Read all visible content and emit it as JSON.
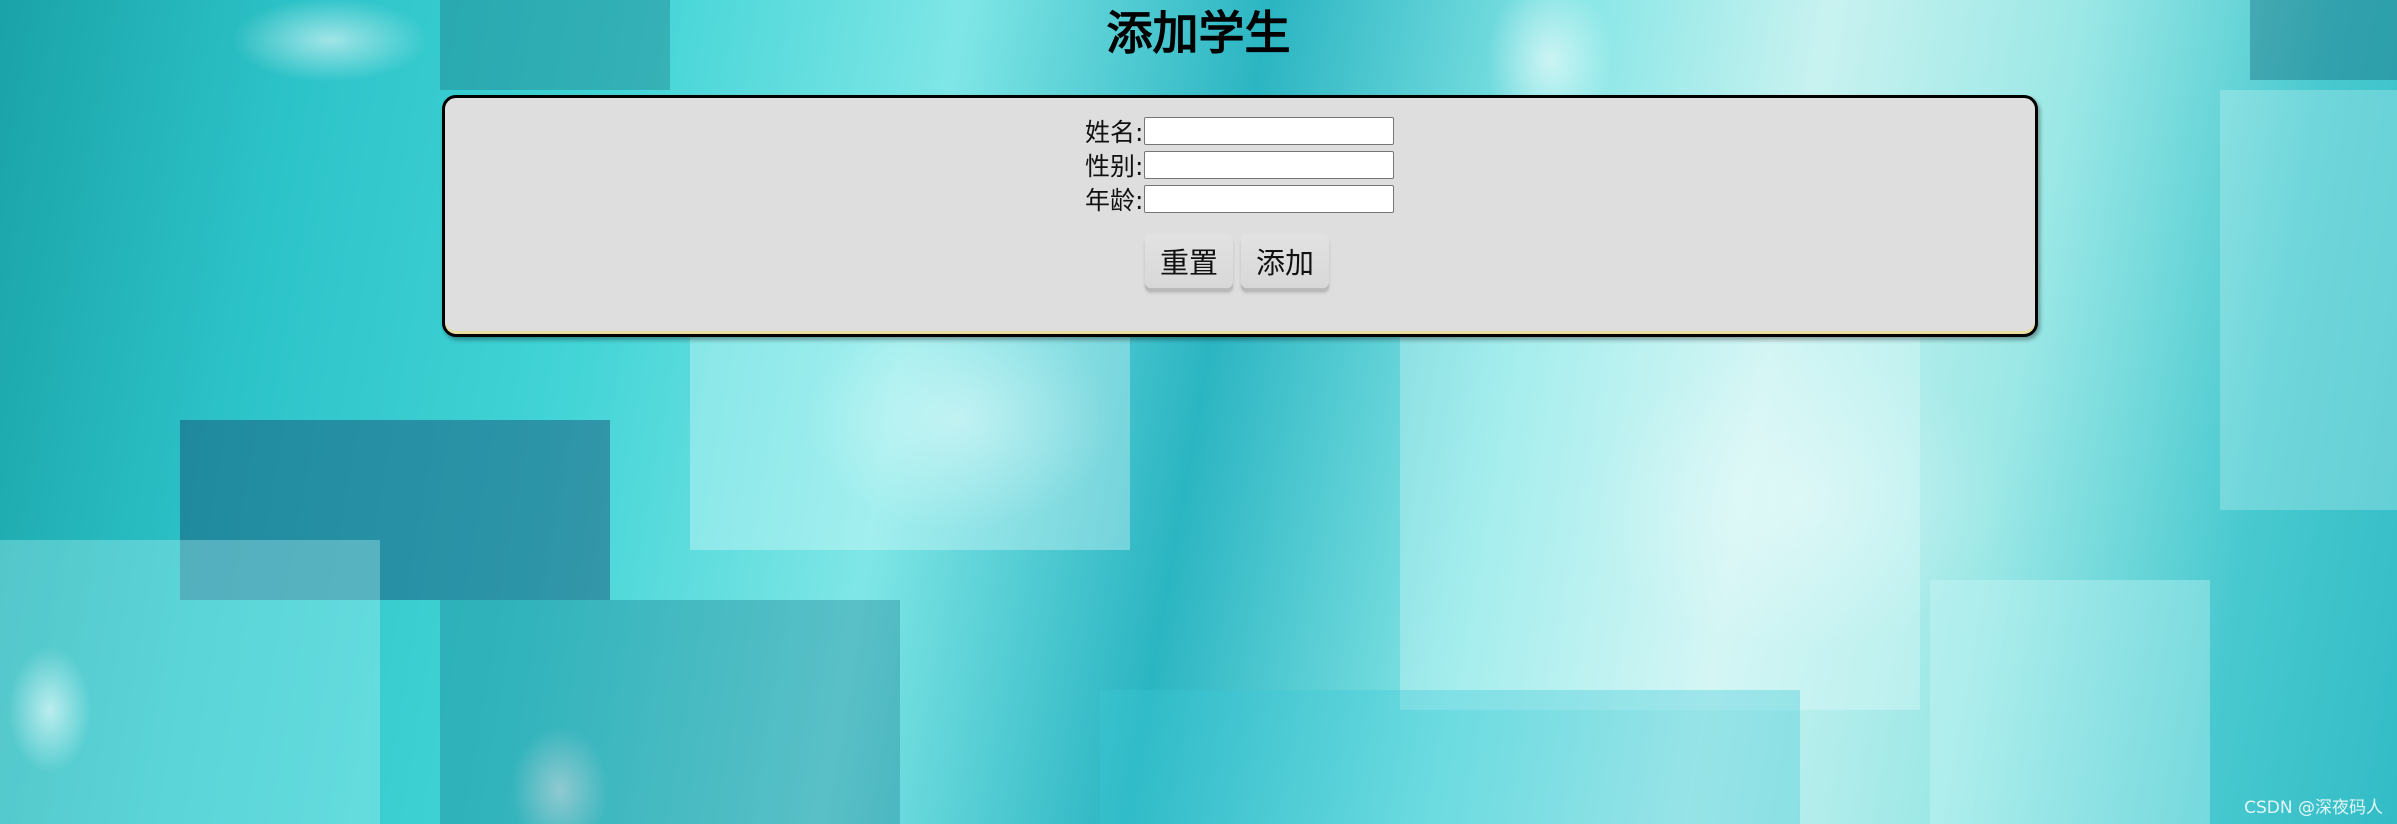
{
  "page": {
    "title": "添加学生",
    "watermark": "CSDN @深夜码人"
  },
  "form": {
    "fields": [
      {
        "label": "姓名:",
        "value": ""
      },
      {
        "label": "性别:",
        "value": ""
      },
      {
        "label": "年龄:",
        "value": ""
      }
    ],
    "reset_label": "重置",
    "submit_label": "添加"
  },
  "colors": {
    "panel_background": "#dedede",
    "panel_border": "#000000",
    "background_accent": "#2cc3c8"
  }
}
